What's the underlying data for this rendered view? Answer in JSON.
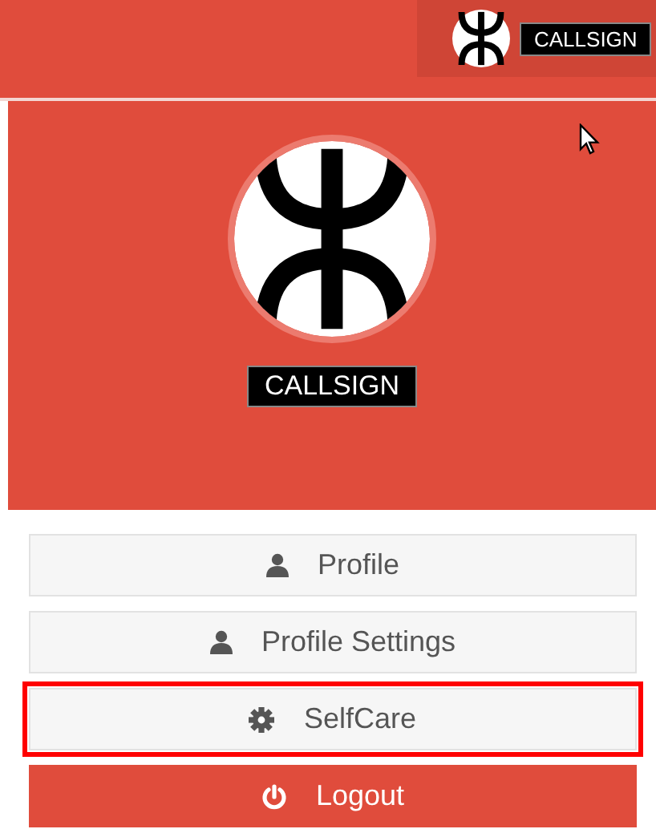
{
  "header": {
    "callsign": "CALLSIGN"
  },
  "profile_panel": {
    "callsign": "CALLSIGN"
  },
  "menu": [
    {
      "kind": "profile",
      "label": "Profile",
      "highlighted": false
    },
    {
      "kind": "settings",
      "label": "Profile Settings",
      "highlighted": false
    },
    {
      "kind": "selfcare",
      "label": "SelfCare",
      "highlighted": true
    },
    {
      "kind": "logout",
      "label": "Logout",
      "highlighted": false
    }
  ]
}
